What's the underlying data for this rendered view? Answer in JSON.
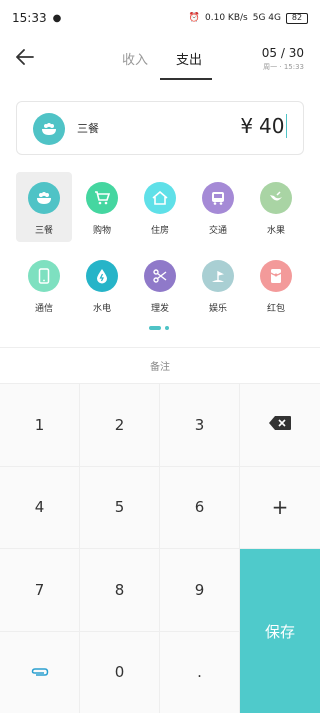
{
  "status_bar": {
    "time": "15:33",
    "net_speed": "0.10 KB/s",
    "signal": "5G 4G",
    "battery": "82"
  },
  "header": {
    "tabs": [
      {
        "label": "收入"
      },
      {
        "label": "支出"
      }
    ],
    "date": "05 / 30",
    "date_sub": "周一 · 15:33"
  },
  "entry": {
    "category": "三餐",
    "currency": "¥",
    "amount": "40"
  },
  "categories": [
    {
      "label": "三餐",
      "icon": "rice-bowl-icon",
      "color": "#4fc3c6"
    },
    {
      "label": "购物",
      "icon": "shopping-cart-icon",
      "color": "#45d6a0"
    },
    {
      "label": "住房",
      "icon": "house-icon",
      "color": "#5fe0e8"
    },
    {
      "label": "交通",
      "icon": "bus-icon",
      "color": "#a58ad6"
    },
    {
      "label": "水果",
      "icon": "fruit-icon",
      "color": "#a9d4a4"
    },
    {
      "label": "通信",
      "icon": "phone-icon",
      "color": "#7ee0c0"
    },
    {
      "label": "水电",
      "icon": "water-drop-icon",
      "color": "#26b4c8"
    },
    {
      "label": "理发",
      "icon": "scissors-icon",
      "color": "#8f79c9"
    },
    {
      "label": "娱乐",
      "icon": "entertainment-icon",
      "color": "#a9cfd3"
    },
    {
      "label": "红包",
      "icon": "red-envelope-icon",
      "color": "#f39a9a"
    }
  ],
  "note_placeholder": "备注",
  "keypad": {
    "keys": [
      "1",
      "2",
      "3",
      "4",
      "5",
      "6",
      "7",
      "8",
      "9",
      "0",
      "."
    ],
    "plus": "+",
    "save": "保存"
  },
  "colors": {
    "accent": "#4fcacb"
  }
}
